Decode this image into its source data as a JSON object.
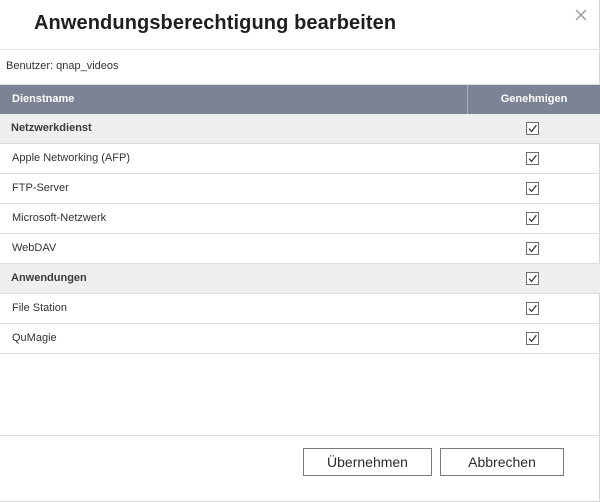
{
  "dialog": {
    "title": "Anwendungsberechtigung bearbeiten",
    "user_label": "Benutzer: qnap_videos"
  },
  "table": {
    "headers": {
      "name": "Dienstname",
      "approve": "Genehmigen"
    },
    "rows": [
      {
        "name": "Netzwerkdienst",
        "group": true,
        "checked": true
      },
      {
        "name": "Apple Networking (AFP)",
        "group": false,
        "checked": true
      },
      {
        "name": "FTP-Server",
        "group": false,
        "checked": true
      },
      {
        "name": "Microsoft-Netzwerk",
        "group": false,
        "checked": true
      },
      {
        "name": "WebDAV",
        "group": false,
        "checked": true
      },
      {
        "name": "Anwendungen",
        "group": true,
        "checked": true
      },
      {
        "name": "File Station",
        "group": false,
        "checked": true
      },
      {
        "name": "QuMagie",
        "group": false,
        "checked": true
      }
    ]
  },
  "footer": {
    "apply_label": "Übernehmen",
    "cancel_label": "Abbrechen"
  }
}
